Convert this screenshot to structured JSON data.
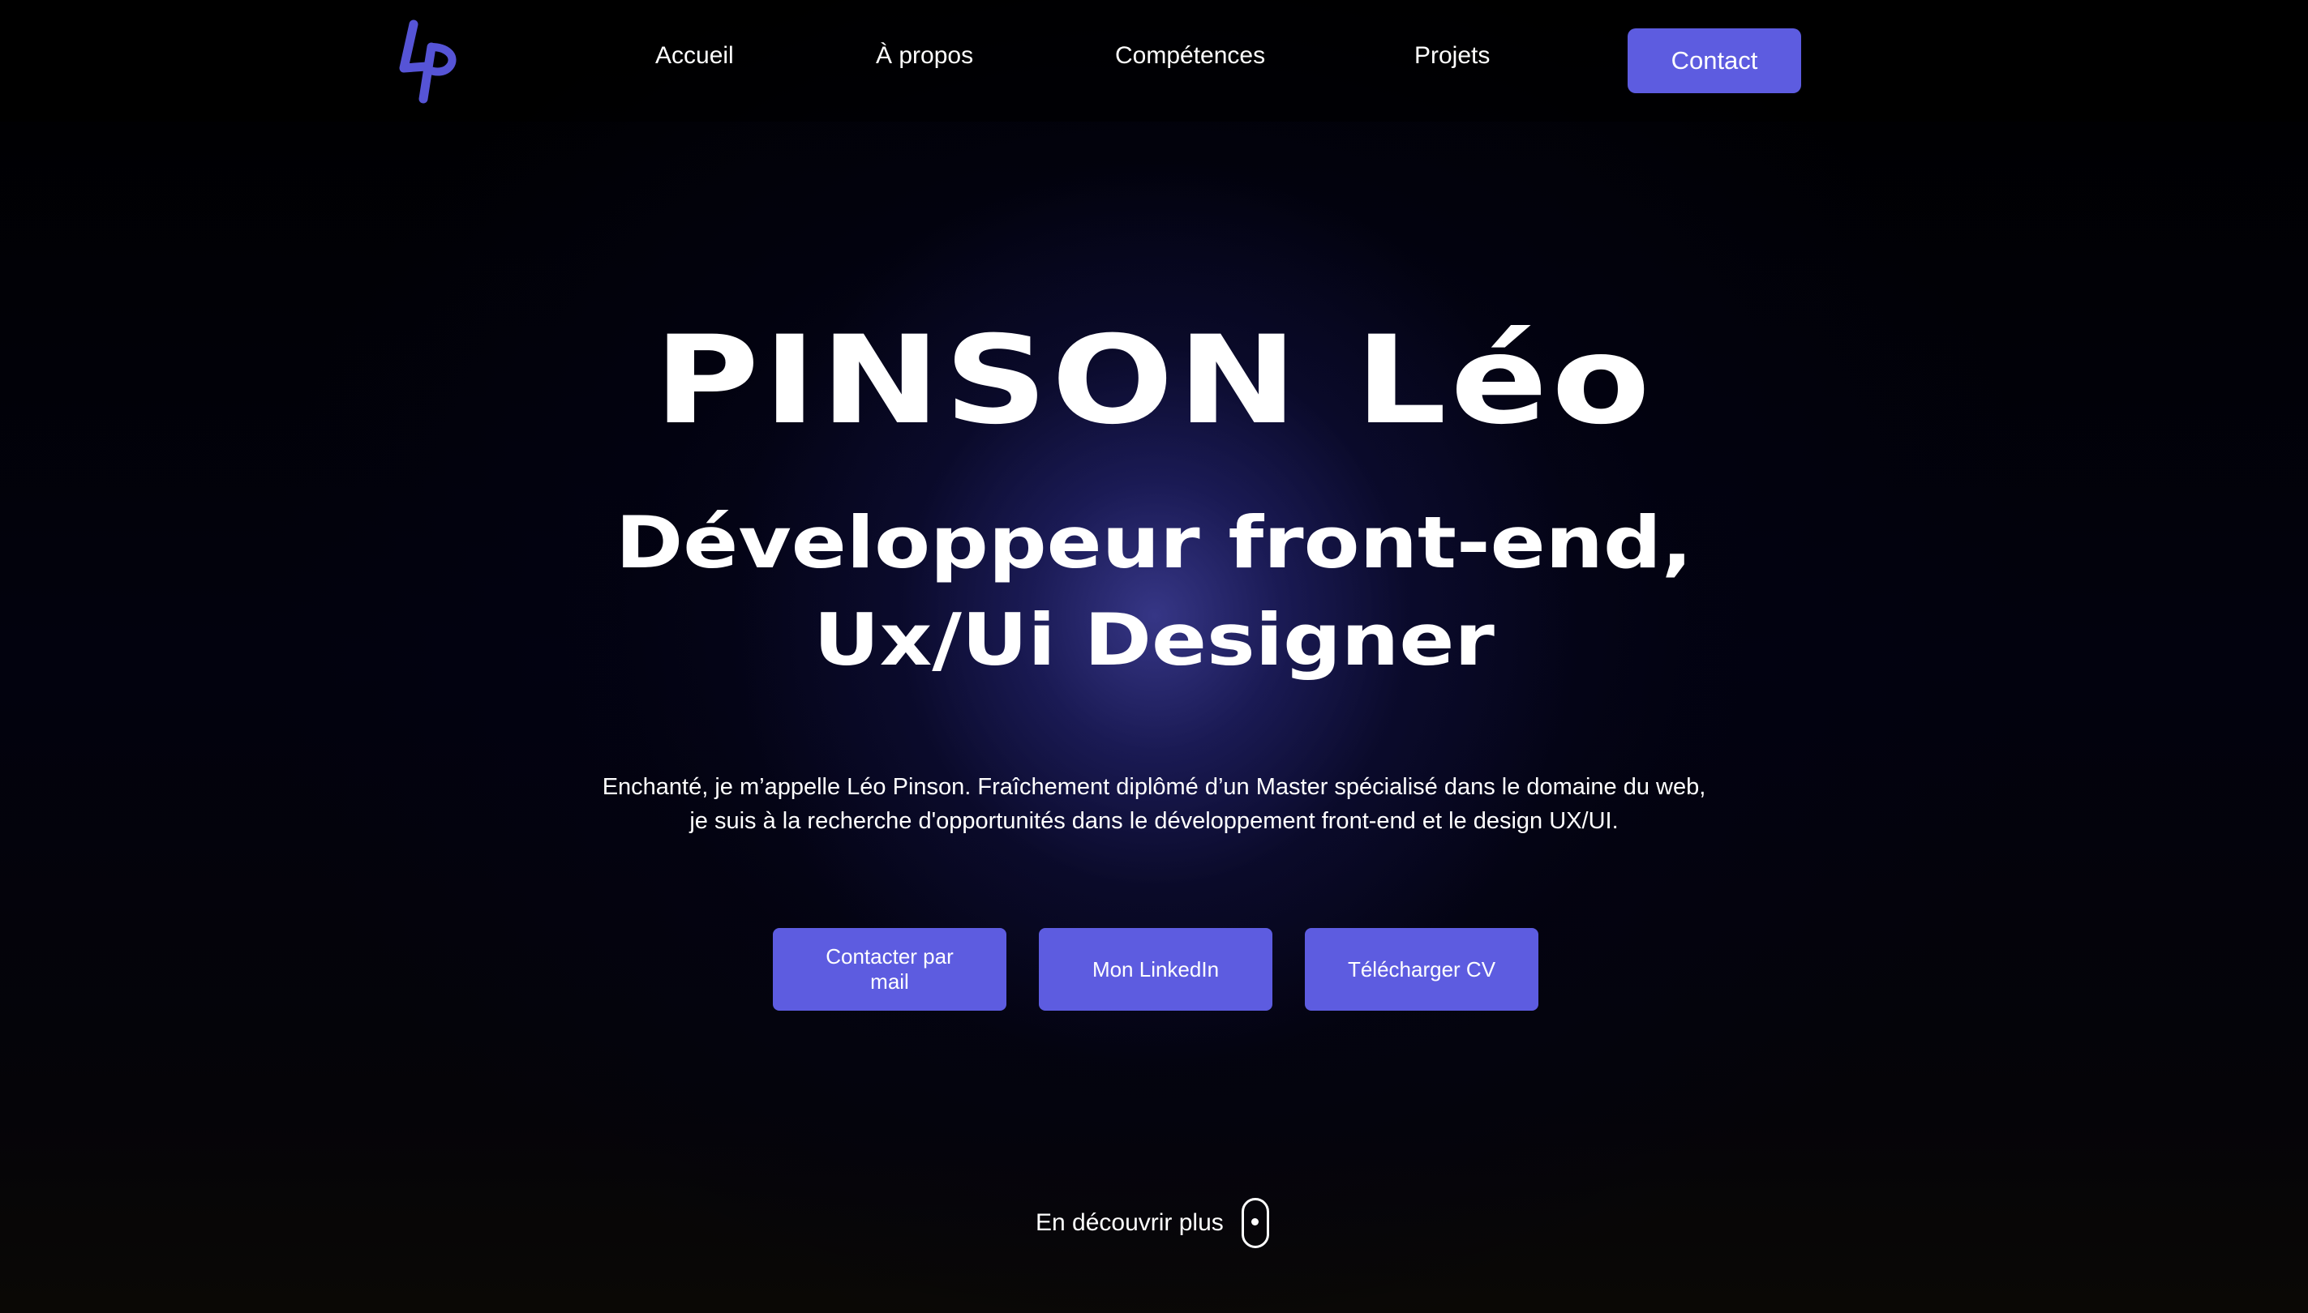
{
  "nav": {
    "logo_icon": "lp-monogram-logo",
    "links": [
      {
        "label": "Accueil"
      },
      {
        "label": "À propos"
      },
      {
        "label": "Compétences"
      },
      {
        "label": "Projets"
      }
    ],
    "contact_label": "Contact"
  },
  "hero": {
    "name": "PINSON Léo",
    "role_line1": "Développeur front-end,",
    "role_line2": "Ux/Ui Designer",
    "desc_line1": "Enchanté, je m’appelle Léo Pinson. Fraîchement diplômé d’un Master spécialisé dans le domaine du web,",
    "desc_line2": "je suis à la recherche d'opportunités dans le développement front-end et le design UX/UI.",
    "buttons": {
      "mail": "Contacter par mail",
      "linkedin": "Mon LinkedIn",
      "cv": "Télécharger CV"
    },
    "scroll_label": "En découvrir plus",
    "scroll_icon": "mouse-scroll-icon"
  },
  "colors": {
    "accent": "#5d5ce0",
    "background": "#000108",
    "text": "#ffffff"
  }
}
